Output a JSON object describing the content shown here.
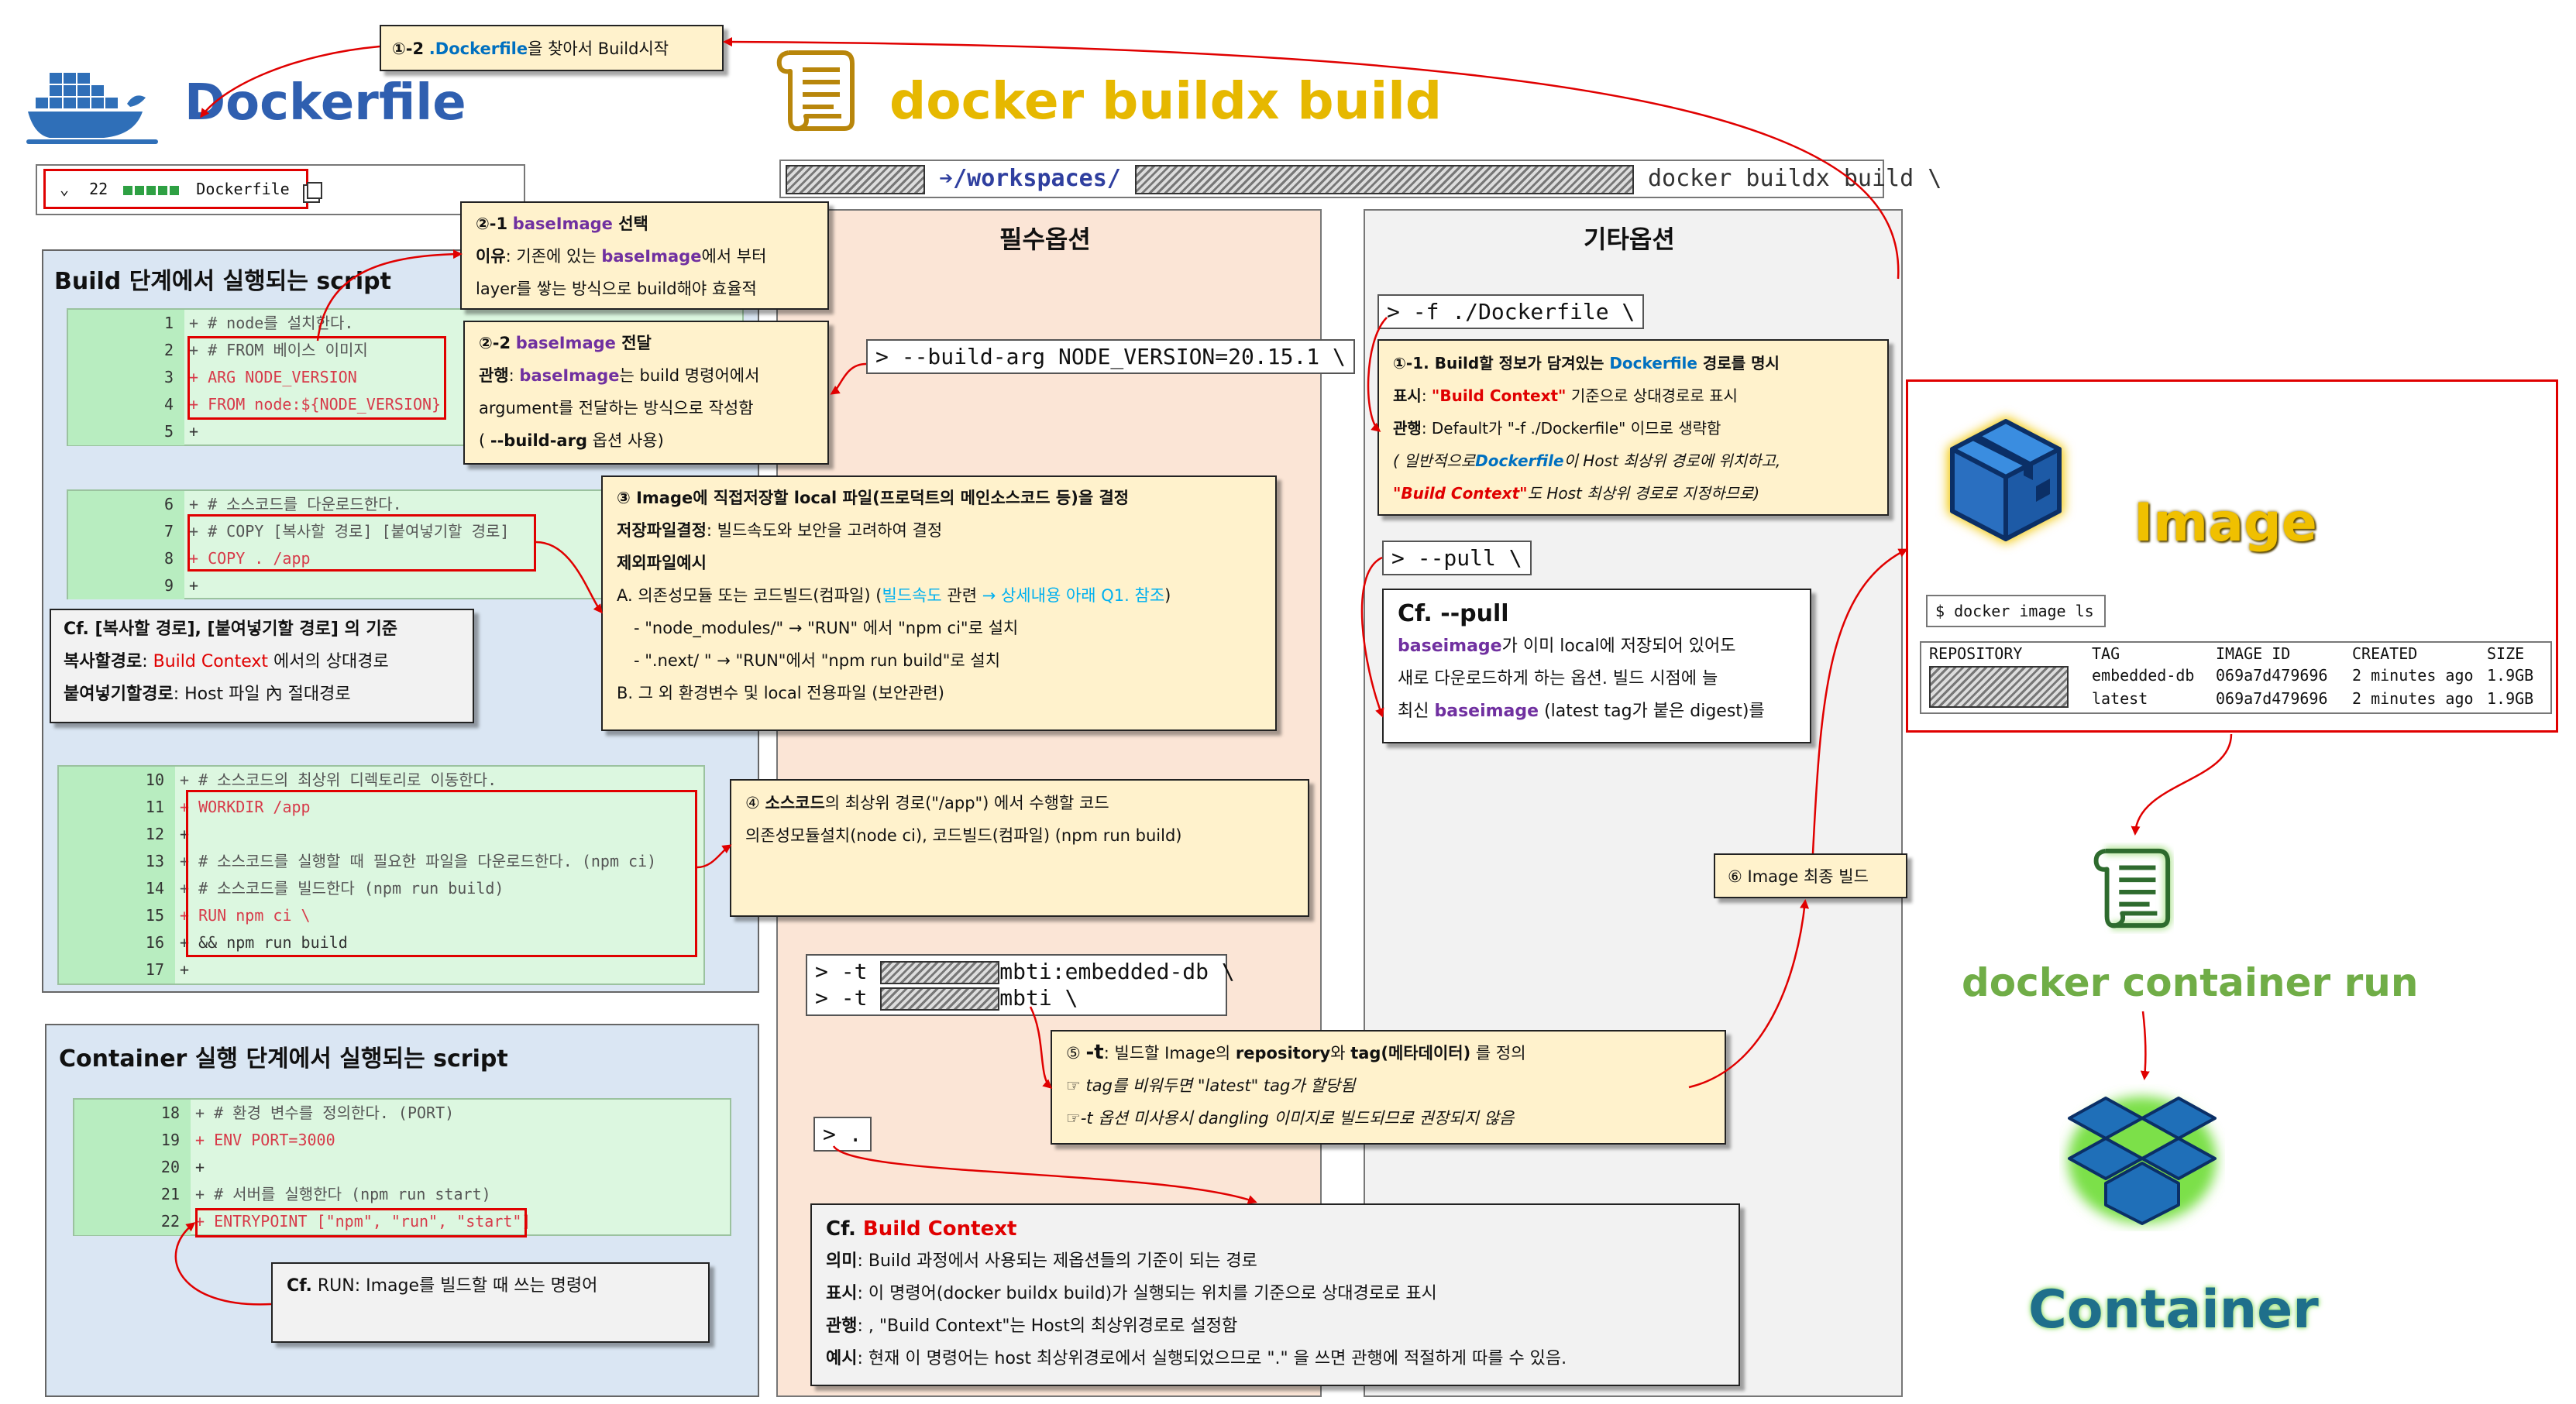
{
  "dockerfile": {
    "title": "Dockerfile",
    "file_bar": {
      "chevron": "⌄",
      "lines": "22",
      "name": "Dockerfile"
    }
  },
  "buildx": {
    "title": "docker buildx build",
    "path": "➔/workspaces/",
    "cmd": "docker buildx build \\"
  },
  "step_1_2": {
    "num": "①-2",
    "file": ".Dockerfile",
    "text": "을 찾아서 Build시작"
  },
  "build_script": {
    "title": "Build 단계에서 실행되는 script",
    "group1": [
      {
        "n": "1",
        "t": "+ # node를 설치한다."
      },
      {
        "n": "2",
        "t": "+ # FROM 베이스 이미지"
      },
      {
        "n": "3",
        "t": "+ ARG NODE_VERSION"
      },
      {
        "n": "4",
        "t": "+ FROM node:${NODE_VERSION}"
      },
      {
        "n": "5",
        "t": "+"
      }
    ],
    "group2": [
      {
        "n": "6",
        "t": "+ # 소스코드를 다운로드한다."
      },
      {
        "n": "7",
        "t": "+ # COPY [복사할 경로] [붙여넣기할 경로]"
      },
      {
        "n": "8",
        "t": "+ COPY . /app"
      },
      {
        "n": "9",
        "t": "+"
      }
    ],
    "group3": [
      {
        "n": "10",
        "t": "+ # 소스코드의 최상위 디렉토리로 이동한다."
      },
      {
        "n": "11",
        "t": "+ WORKDIR /app"
      },
      {
        "n": "12",
        "t": "+"
      },
      {
        "n": "13",
        "t": "+ # 소스코드를 실행할 때 필요한 파일을 다운로드한다. (npm ci)"
      },
      {
        "n": "14",
        "t": "+ # 소스코드를 빌드한다 (npm run build)"
      },
      {
        "n": "15",
        "t": "+ RUN npm ci \\"
      },
      {
        "n": "16",
        "t": "+ && npm run build"
      },
      {
        "n": "17",
        "t": "+"
      }
    ]
  },
  "container_script": {
    "title": "Container 실행 단계에서 실행되는 script",
    "rows": [
      {
        "n": "18",
        "t": "+ # 환경 변수를 정의한다. (PORT)"
      },
      {
        "n": "19",
        "t": "+ ENV PORT=3000"
      },
      {
        "n": "20",
        "t": "+"
      },
      {
        "n": "21",
        "t": "+ # 서버를 실행한다 (npm run start)"
      },
      {
        "n": "22",
        "t": "+ ENTRYPOINT [\"npm\", \"run\", \"start\"]"
      }
    ]
  },
  "note_2_1": {
    "num": "②-1",
    "key": "baseImage",
    "title": " 선택",
    "l2a": "이유",
    "l2b": ": 기존에 있는 ",
    "l2c": "baseImage",
    "l2d": "에서 부터",
    "l3": "layer를 쌓는 방식으로 build해야 효율적"
  },
  "note_2_2": {
    "num": "②-2",
    "key": "baseImage",
    "title": " 전달",
    "l2a": "관행",
    "l2b": ": ",
    "l2c": "baseImage",
    "l2d": "는 build 명령어에서",
    "l3": "argument를 전달하는 방식으로 작성함",
    "l4a": "( ",
    "l4b": "--build-arg",
    "l4c": " 옵션 사용)"
  },
  "note_3": {
    "l1": "③ Image에 직접저장할 local 파일(프로덕트의 메인소스코드 등)을 결정",
    "l2a": "저장파일결정",
    "l2b": ": 빌드속도와 보안을 고려하여 결정",
    "l3": "제외파일예시",
    "l4a": "A. 의존성모듈 또는 코드빌드(컴파일) (",
    "l4b": "빌드속도",
    "l4c": " 관련 ",
    "l4d": "→ 상세내용 아래 Q1. 참조",
    "l4e": ")",
    "l5": "- \"node_modules/\" → \"RUN\" 에서 \"npm ci\"로 설치",
    "l6": "- \".next/ \" → \"RUN\"에서 \"npm run build\"로 설치",
    "l7": "B. 그 외 환경변수 및 local 전용파일 (보안관련)"
  },
  "note_cf_copy": {
    "l1": "Cf. [복사할 경로], [붙여넣기할 경로] 의 기준",
    "l2a": "복사할경로",
    "l2b": ": ",
    "l2c": "Build Context",
    "l2d": " 에서의 상대경로",
    "l3a": "붙여넣기할경로",
    "l3b": ": Host 파일 內 절대경로"
  },
  "note_4": {
    "l1a": "④ ",
    "l1b": "소스코드",
    "l1c": "의 최상위 경로(\"/app\") 에서 수행할 코드",
    "l2": "의존성모듈설치(node ci), 코드빌드(컴파일) (npm run build)"
  },
  "note_cf_run": {
    "a": "Cf.",
    "b": " RUN: Image를 빌드할 때 쓰는 명령어"
  },
  "required": {
    "title": "필수옵션",
    "build_arg": "> --build-arg NODE_VERSION=20.15.1 \\",
    "tag1a": "> -t ",
    "tag1b": "mbti:embedded-db \\",
    "tag2a": "> -t ",
    "tag2b": "mbti \\",
    "dot": "> ."
  },
  "other": {
    "title": "기타옵션",
    "f": "> -f ./Dockerfile \\",
    "pull": "> --pull \\"
  },
  "note_1_1": {
    "l1a": "①-1. Build할 정보가 담겨있는 ",
    "l1b": "Dockerfile",
    "l1c": " 경로를 명시",
    "l2a": "표시",
    "l2b": ": ",
    "l2c": "\"Build Context\"",
    "l2d": " 기준으로 상대경로로 표시",
    "l3a": "관행",
    "l3b": ": Default가 \"-f ./Dockerfile\" 이므로 생략함",
    "l4a": "( 일반적으로",
    "l4b": "Dockerfile",
    "l4c": "이 Host 최상위 경로에 위치하고,",
    "l5a": "\"Build Context\"",
    "l5b": "도 Host 최상위 경로로 지정하므로)"
  },
  "note_pull": {
    "title": "Cf. --pull",
    "l2a": "baseimage",
    "l2b": "가 이미 local에 저장되어 있어도",
    "l3": "새로 다운로드하게 하는 옵션. 빌드 시점에 늘",
    "l4a": "최신 ",
    "l4b": "baseimage",
    "l4c": " (latest tag가 붙은 digest)를"
  },
  "note_5": {
    "l1a": "⑤ ",
    "l1b": "-t",
    "l1c": ": 빌드할 Image의 ",
    "l1d": "repository",
    "l1e": "와 ",
    "l1f": "tag(메타데이터)",
    "l1g": " 를 정의",
    "l2": "☞ tag를 비워두면 \"latest\" tag가 할당됨",
    "l3": "☞-t 옵션 미사용시 dangling 이미지로 빌드되므로 권장되지 않음"
  },
  "note_6": {
    "text": "⑥ Image 최종 빌드"
  },
  "note_build_context": {
    "title_a": "Cf. ",
    "title_b": "Build Context",
    "l2a": "의미",
    "l2b": ": Build 과정에서 사용되는 제옵션들의 기준이 되는 경로",
    "l3a": "표시",
    "l3b": ": 이 명령어(docker buildx build)가 실행되는 위치를 기준으로 상대경로로 표시",
    "l4a": "관행",
    "l4b": ": , \"Build Context\"는 Host의 최상위경로로 설정함",
    "l5a": "예시",
    "l5b": ": 현재 이 명령어는 host 최상위경로에서 실행되었으므로 \".\" 을 쓰면 관행에 적절하게 따를 수 있음."
  },
  "image": {
    "title": "Image",
    "cmd": "$ docker image ls",
    "headers": [
      "REPOSITORY",
      "TAG",
      "IMAGE ID",
      "CREATED",
      "SIZE"
    ],
    "rows": [
      [
        "",
        "embedded-db",
        "069a7d479696",
        "2 minutes ago",
        "1.9GB"
      ],
      [
        "",
        "latest",
        "069a7d479696",
        "2 minutes ago",
        "1.9GB"
      ]
    ]
  },
  "run_title": "docker container run",
  "container_title": "Container",
  "colors": {
    "red": "#e00000",
    "purple": "#7030a0",
    "blue": "#0070c0",
    "gold": "#e6b800",
    "green": "#70ad47",
    "container": "#1f6f8b"
  }
}
